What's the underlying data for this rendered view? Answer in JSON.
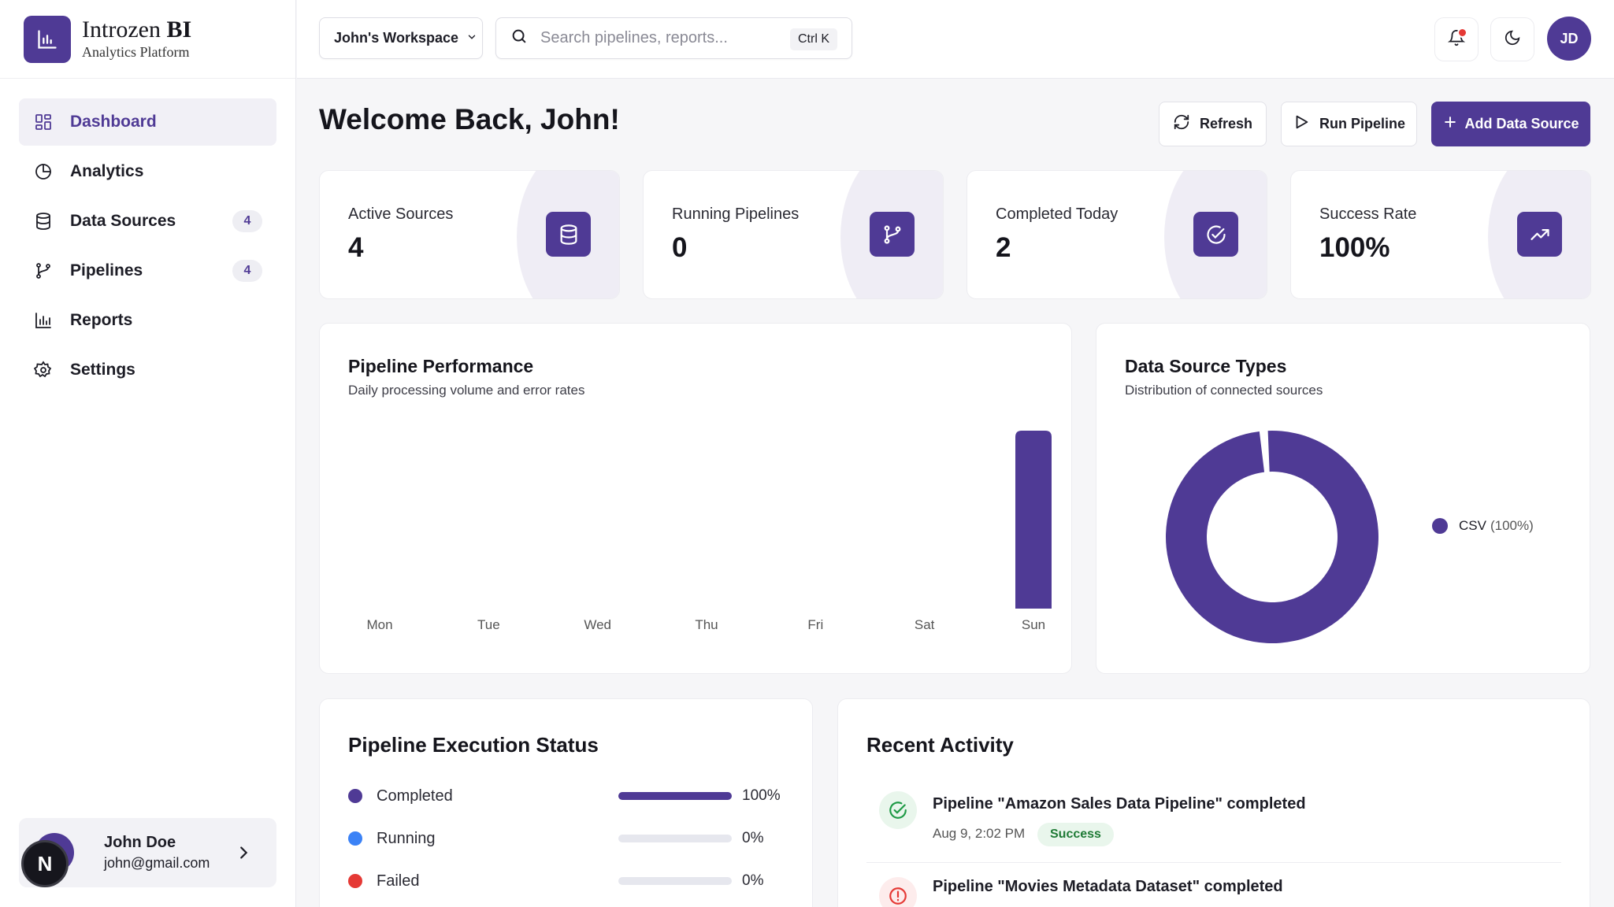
{
  "brand": {
    "name_regular": "Introzen",
    "name_bold": "BI",
    "subtitle": "Analytics Platform"
  },
  "sidebar": {
    "items": [
      {
        "label": "Dashboard",
        "icon": "grid-icon",
        "active": true,
        "badge": ""
      },
      {
        "label": "Analytics",
        "icon": "pie-chart-icon",
        "active": false,
        "badge": ""
      },
      {
        "label": "Data Sources",
        "icon": "database-icon",
        "active": false,
        "badge": "4"
      },
      {
        "label": "Pipelines",
        "icon": "git-branch-icon",
        "active": false,
        "badge": "4"
      },
      {
        "label": "Reports",
        "icon": "bar-chart-icon",
        "active": false,
        "badge": ""
      },
      {
        "label": "Settings",
        "icon": "gear-icon",
        "active": false,
        "badge": ""
      }
    ],
    "user": {
      "name": "John Doe",
      "email": "john@gmail.com",
      "overlay_badge": "N"
    }
  },
  "topbar": {
    "workspace": "John's Workspace",
    "search_placeholder": "Search pipelines, reports...",
    "search_shortcut": "Ctrl K",
    "avatar_initials": "JD"
  },
  "header": {
    "welcome": "Welcome Back, John!",
    "refresh_label": "Refresh",
    "run_label": "Run Pipeline",
    "add_label": "Add Data Source"
  },
  "stats": [
    {
      "label": "Active Sources",
      "value": "4",
      "icon": "database-icon"
    },
    {
      "label": "Running Pipelines",
      "value": "0",
      "icon": "git-branch-icon"
    },
    {
      "label": "Completed Today",
      "value": "2",
      "icon": "check-circle-icon"
    },
    {
      "label": "Success Rate",
      "value": "100%",
      "icon": "trending-up-icon"
    }
  ],
  "performance": {
    "title": "Pipeline Performance",
    "subtitle": "Daily processing volume and error rates"
  },
  "source_types": {
    "title": "Data Source Types",
    "subtitle": "Distribution of connected sources",
    "legend": [
      {
        "name": "CSV",
        "pct": "(100%)"
      }
    ]
  },
  "chart_data": [
    {
      "type": "bar",
      "categories": [
        "Mon",
        "Tue",
        "Wed",
        "Thu",
        "Fri",
        "Sat",
        "Sun"
      ],
      "values": [
        0,
        0,
        0,
        0,
        0,
        0,
        1
      ],
      "ylim": [
        0,
        1
      ],
      "grid": false,
      "colors": {
        "bar": "#4f3a95"
      }
    },
    {
      "type": "pie",
      "categories": [
        "CSV"
      ],
      "values": [
        100
      ],
      "legend": "right",
      "colors": {
        "CSV": "#4f3a95"
      }
    }
  ],
  "execution_status": {
    "title": "Pipeline Execution Status",
    "rows": [
      {
        "label": "Completed",
        "pct": "100%",
        "fraction": 1.0,
        "color": "#4f3a95"
      },
      {
        "label": "Running",
        "pct": "0%",
        "fraction": 0.0,
        "color": "#3b82f6"
      },
      {
        "label": "Failed",
        "pct": "0%",
        "fraction": 0.0,
        "color": "#e53935"
      }
    ]
  },
  "recent_activity": {
    "title": "Recent Activity",
    "items": [
      {
        "title": "Pipeline \"Amazon Sales Data Pipeline\" completed",
        "time": "Aug 9, 2:02 PM",
        "badge": "Success",
        "status": "success"
      },
      {
        "title": "Pipeline \"Movies Metadata Dataset\" completed",
        "time": "",
        "badge": "",
        "status": "error"
      }
    ]
  },
  "colors": {
    "accent": "#4f3a95",
    "success": "#1e7a35",
    "error": "#e53935",
    "running": "#3b82f6"
  }
}
